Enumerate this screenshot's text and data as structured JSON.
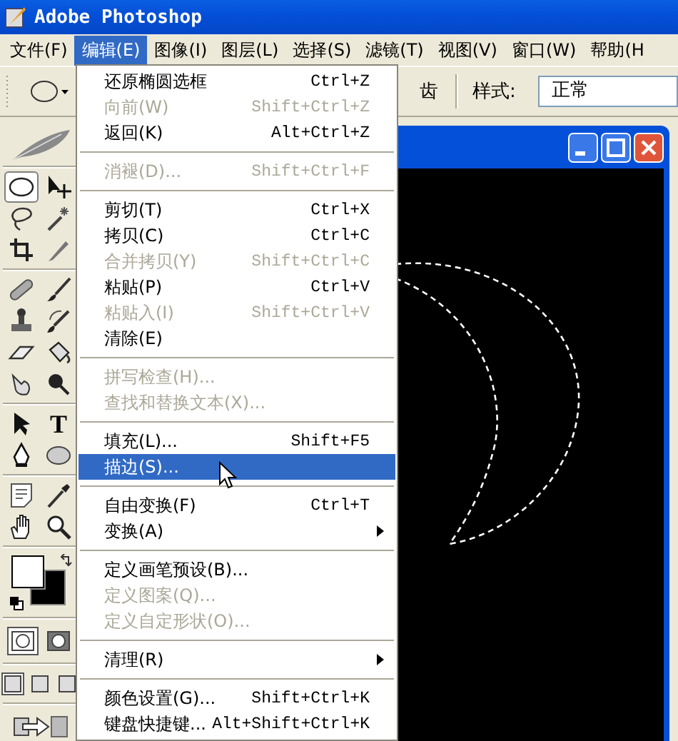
{
  "window": {
    "title": "Adobe Photoshop"
  },
  "menu_bar": [
    {
      "label": "文件(F)",
      "selected": false
    },
    {
      "label": "编辑(E)",
      "selected": true
    },
    {
      "label": "图像(I)",
      "selected": false
    },
    {
      "label": "图层(L)",
      "selected": false
    },
    {
      "label": "选择(S)",
      "selected": false
    },
    {
      "label": "滤镜(T)",
      "selected": false
    },
    {
      "label": "视图(V)",
      "selected": false
    },
    {
      "label": "窗口(W)",
      "selected": false
    },
    {
      "label": "帮助(H",
      "selected": false
    }
  ],
  "options_bar": {
    "antialias_label": "齿",
    "style_label": "样式:",
    "style_value": "正常"
  },
  "edit_menu": [
    {
      "kind": "item",
      "label": "还原椭圆选框",
      "shortcut": "Ctrl+Z",
      "disabled": false,
      "selected": false,
      "submenu": false
    },
    {
      "kind": "item",
      "label": "向前(W)",
      "shortcut": "Shift+Ctrl+Z",
      "disabled": true,
      "selected": false,
      "submenu": false
    },
    {
      "kind": "item",
      "label": "返回(K)",
      "shortcut": "Alt+Ctrl+Z",
      "disabled": false,
      "selected": false,
      "submenu": false
    },
    {
      "kind": "separator"
    },
    {
      "kind": "item",
      "label": "消褪(D)...",
      "shortcut": "Shift+Ctrl+F",
      "disabled": true,
      "selected": false,
      "submenu": false
    },
    {
      "kind": "separator"
    },
    {
      "kind": "item",
      "label": "剪切(T)",
      "shortcut": "Ctrl+X",
      "disabled": false,
      "selected": false,
      "submenu": false
    },
    {
      "kind": "item",
      "label": "拷贝(C)",
      "shortcut": "Ctrl+C",
      "disabled": false,
      "selected": false,
      "submenu": false
    },
    {
      "kind": "item",
      "label": "合并拷贝(Y)",
      "shortcut": "Shift+Ctrl+C",
      "disabled": true,
      "selected": false,
      "submenu": false
    },
    {
      "kind": "item",
      "label": "粘贴(P)",
      "shortcut": "Ctrl+V",
      "disabled": false,
      "selected": false,
      "submenu": false
    },
    {
      "kind": "item",
      "label": "粘贴入(I)",
      "shortcut": "Shift+Ctrl+V",
      "disabled": true,
      "selected": false,
      "submenu": false
    },
    {
      "kind": "item",
      "label": "清除(E)",
      "disabled": false,
      "selected": false,
      "submenu": false
    },
    {
      "kind": "separator"
    },
    {
      "kind": "item",
      "label": "拼写检查(H)...",
      "disabled": true,
      "selected": false,
      "submenu": false
    },
    {
      "kind": "item",
      "label": "查找和替换文本(X)...",
      "disabled": true,
      "selected": false,
      "submenu": false
    },
    {
      "kind": "separator"
    },
    {
      "kind": "item",
      "label": "填充(L)...",
      "shortcut": "Shift+F5",
      "disabled": false,
      "selected": false,
      "submenu": false
    },
    {
      "kind": "item",
      "label": "描边(S)...",
      "disabled": false,
      "selected": true,
      "submenu": false
    },
    {
      "kind": "separator"
    },
    {
      "kind": "item",
      "label": "自由变换(F)",
      "shortcut": "Ctrl+T",
      "disabled": false,
      "selected": false,
      "submenu": false
    },
    {
      "kind": "item",
      "label": "变换(A)",
      "disabled": false,
      "selected": false,
      "submenu": true
    },
    {
      "kind": "separator"
    },
    {
      "kind": "item",
      "label": "定义画笔预设(B)...",
      "disabled": false,
      "selected": false,
      "submenu": false
    },
    {
      "kind": "item",
      "label": "定义图案(Q)...",
      "disabled": true,
      "selected": false,
      "submenu": false
    },
    {
      "kind": "item",
      "label": "定义自定形状(O)...",
      "disabled": true,
      "selected": false,
      "submenu": false
    },
    {
      "kind": "separator"
    },
    {
      "kind": "item",
      "label": "清理(R)",
      "disabled": false,
      "selected": false,
      "submenu": true
    },
    {
      "kind": "separator"
    },
    {
      "kind": "item",
      "label": "颜色设置(G)...",
      "shortcut": "Shift+Ctrl+K",
      "disabled": false,
      "selected": false,
      "submenu": false
    },
    {
      "kind": "item",
      "label": "键盘快捷键...",
      "shortcut": "Alt+Shift+Ctrl+K",
      "disabled": false,
      "selected": false,
      "submenu": false
    }
  ],
  "toolbox": {
    "groups": [
      {
        "tools": [
          {
            "kind": "ellipse-marquee",
            "selected": true
          },
          {
            "kind": "move",
            "selected": false
          },
          {
            "kind": "lasso",
            "selected": false
          },
          {
            "kind": "magic-wand",
            "selected": false
          },
          {
            "kind": "crop",
            "selected": false
          },
          {
            "kind": "slice",
            "selected": false
          }
        ]
      },
      {
        "tools": [
          {
            "kind": "healing",
            "selected": false
          },
          {
            "kind": "brush",
            "selected": false
          },
          {
            "kind": "stamp",
            "selected": false
          },
          {
            "kind": "history-brush",
            "selected": false
          },
          {
            "kind": "eraser",
            "selected": false
          },
          {
            "kind": "bucket",
            "selected": false
          },
          {
            "kind": "smudge",
            "selected": false
          },
          {
            "kind": "burn",
            "selected": false
          }
        ]
      },
      {
        "tools": [
          {
            "kind": "path-select",
            "selected": false
          },
          {
            "kind": "type",
            "glyph": "T",
            "selected": false
          },
          {
            "kind": "pen",
            "selected": false
          },
          {
            "kind": "shape",
            "selected": false
          }
        ]
      },
      {
        "tools": [
          {
            "kind": "notes",
            "selected": false
          },
          {
            "kind": "eyedropper",
            "selected": false
          },
          {
            "kind": "hand",
            "selected": false
          },
          {
            "kind": "zoom",
            "selected": false
          }
        ]
      }
    ],
    "mask_modes": [
      {
        "selected": true
      },
      {
        "selected": false
      }
    ],
    "screen_modes": [
      {
        "selected": true
      },
      {
        "selected": false
      },
      {
        "selected": false
      }
    ]
  }
}
